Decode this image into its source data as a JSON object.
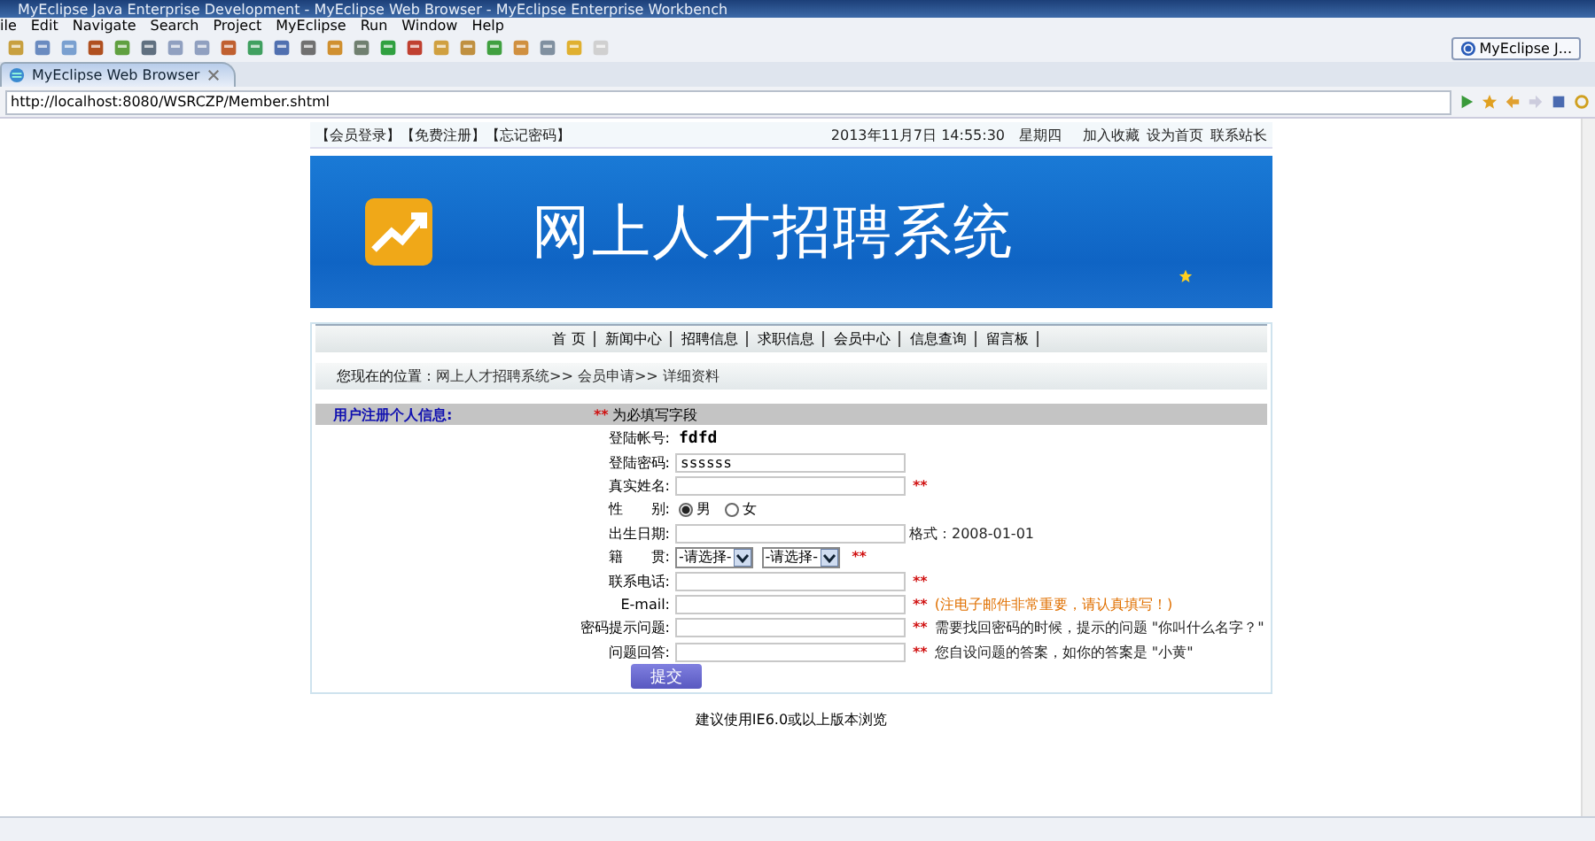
{
  "window": {
    "title": "MyEclipse Java Enterprise Development - MyEclipse Web Browser - MyEclipse Enterprise Workbench"
  },
  "menu": [
    "ile",
    "Edit",
    "Navigate",
    "Search",
    "Project",
    "MyEclipse",
    "Run",
    "Window",
    "Help"
  ],
  "perspective": {
    "label": "MyEclipse J..."
  },
  "editor_tab": {
    "label": "MyEclipse Web Browser"
  },
  "address_bar": {
    "url": "http://localhost:8080/WSRCZP/Member.shtml"
  },
  "page": {
    "top_links": "【会员登录】【免费注册】【忘记密码】",
    "datetime": "2013年11月7日 14:55:30",
    "weekday": "星期四",
    "top_right_links": [
      "加入收藏",
      "设为首页",
      "联系站长"
    ],
    "banner_title": "网上人才招聘系统",
    "nav": [
      "首 页",
      "新闻中心",
      "招聘信息",
      "求职信息",
      "会员中心",
      "信息查询",
      "留言板"
    ],
    "breadcrumb": {
      "prefix": "您现在的位置：",
      "path": "网上人才招聘系统>> 会员申请>> 详细资料"
    },
    "section": {
      "title": "用户注册个人信息:",
      "required_mark": "**",
      "required_note": "为必填写字段"
    },
    "form_rows": [
      {
        "label": "登陆帐号:",
        "kind": "static",
        "value": "fdfd"
      },
      {
        "label": "登陆密码:",
        "kind": "input",
        "value": "ssssss"
      },
      {
        "label": "真实姓名:",
        "kind": "input",
        "mark": "**"
      },
      {
        "label": "性　　别:",
        "kind": "radio",
        "options": [
          {
            "label": "男",
            "selected": true
          },
          {
            "label": "女",
            "selected": false
          }
        ]
      },
      {
        "label": "出生日期:",
        "kind": "input",
        "note": "格式：2008-01-01",
        "note_highlight": false
      },
      {
        "label": "籍　　贯:",
        "kind": "select",
        "selects": [
          "-请选择-",
          "-请选择-"
        ],
        "mark": "**"
      },
      {
        "label": "联系电话:",
        "kind": "input",
        "mark": "**"
      },
      {
        "label": "E-mail:",
        "kind": "input",
        "mark": "**",
        "note": "(注电子邮件非常重要，请认真填写！)",
        "note_highlight": true
      },
      {
        "label": "密码提示问题:",
        "kind": "input",
        "mark": "**",
        "note": "需要找回密码的时候，提示的问题 \"你叫什么名字？\"",
        "note_highlight": false
      },
      {
        "label": "问题回答:",
        "kind": "input",
        "mark": "**",
        "note": "您自设问题的答案，如你的答案是 \"小黄\"",
        "note_highlight": false
      }
    ],
    "submit": "提交",
    "footer": "建议使用IE6.0或以上版本浏览"
  }
}
